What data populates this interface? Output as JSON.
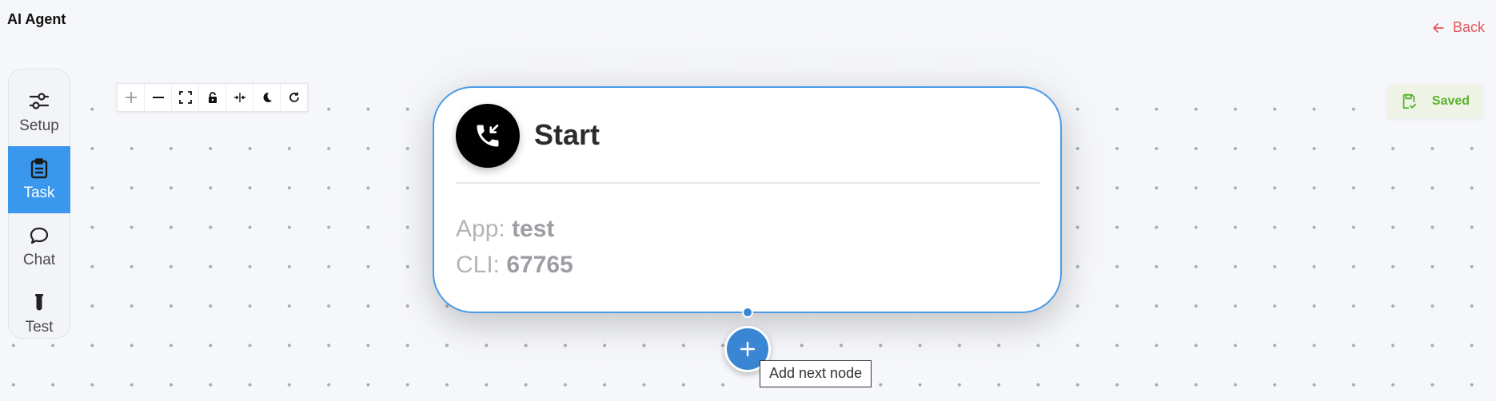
{
  "header": {
    "app_title": "AI Agent",
    "back_label": "Back"
  },
  "sidebar": {
    "items": [
      {
        "label": "Setup",
        "icon": "sliders-icon",
        "active": false
      },
      {
        "label": "Task",
        "icon": "clipboard-icon",
        "active": true
      },
      {
        "label": "Chat",
        "icon": "chat-bubble-icon",
        "active": false
      },
      {
        "label": "Test",
        "icon": "test-tube-icon",
        "active": false
      }
    ]
  },
  "toolbar": {
    "buttons": [
      "zoom-in-icon",
      "zoom-out-icon",
      "fit-view-icon",
      "lock-icon",
      "split-icon",
      "dark-mode-icon",
      "refresh-icon"
    ]
  },
  "node": {
    "title": "Start",
    "icon": "incoming-call-icon",
    "app_label": "App:",
    "app_value": "test",
    "cli_label": "CLI:",
    "cli_value": "67765"
  },
  "add_node": {
    "tooltip": "Add next node"
  },
  "status": {
    "saved_label": "Saved"
  },
  "colors": {
    "accent": "#3a97ee",
    "node_border": "#4a9be8",
    "back_link": "#e2575b",
    "saved_text": "#58b22c"
  }
}
